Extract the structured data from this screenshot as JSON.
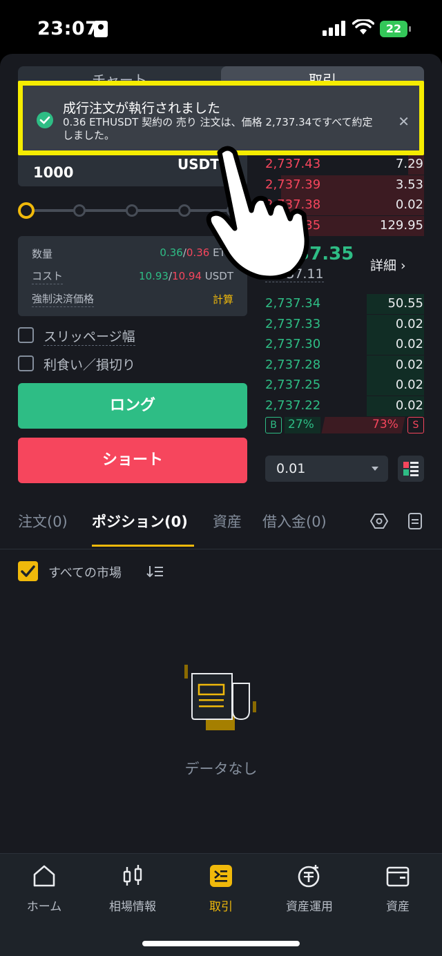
{
  "status_bar": {
    "time": "23:07",
    "battery": "22"
  },
  "top_tabs": [
    {
      "label": "チャート"
    },
    {
      "label": "取引"
    }
  ],
  "order_form": {
    "amount_value": "1000",
    "amount_unit": "USDT",
    "info": {
      "qty_label": "数量",
      "qty_val_a": "0.36",
      "qty_sep": "/",
      "qty_val_b": "0.36",
      "qty_unit": "ETH",
      "cost_label": "コスト",
      "cost_val_a": "10.93",
      "cost_sep": "/",
      "cost_val_b": "10.94",
      "cost_unit": "USDT",
      "liq_label": "強制決済価格",
      "liq_val": "計算"
    },
    "slippage_label": "スリッページ幅",
    "tpsl_label": "利食い／損切り",
    "long_label": "ロング",
    "short_label": "ショート"
  },
  "order_book": {
    "asks": [
      {
        "price": "2,737.43",
        "qty": "7.29",
        "depth": 0.1
      },
      {
        "price": "2,737.39",
        "qty": "3.53",
        "depth": 0.9
      },
      {
        "price": "2,737.38",
        "qty": "0.02",
        "depth": 0.9
      },
      {
        "price": "2,737.35",
        "qty": "129.95",
        "depth": 1.0
      }
    ],
    "mid_price": "2,737.35",
    "mark_price": "2,737.11",
    "detail_label": "詳細 ›",
    "bids": [
      {
        "price": "2,737.34",
        "qty": "50.55",
        "depth": 0.36
      },
      {
        "price": "2,737.33",
        "qty": "0.02",
        "depth": 0.36
      },
      {
        "price": "2,737.30",
        "qty": "0.02",
        "depth": 0.36
      },
      {
        "price": "2,737.28",
        "qty": "0.02",
        "depth": 0.36
      },
      {
        "price": "2,737.25",
        "qty": "0.02",
        "depth": 0.36
      },
      {
        "price": "2,737.22",
        "qty": "0.02",
        "depth": 0.36
      }
    ],
    "buy_tag": "B",
    "buy_pct": "27%",
    "sell_pct": "73%",
    "sell_tag": "S",
    "depth_value": "0.01"
  },
  "sub_tabs": [
    {
      "label": "注文(0)"
    },
    {
      "label": "ポジション(0)"
    },
    {
      "label": "資産"
    },
    {
      "label": "借入金(0)"
    }
  ],
  "filter_label": "すべての市場",
  "empty_text": "データなし",
  "bottom_nav": [
    {
      "label": "ホーム",
      "icon": "home-icon"
    },
    {
      "label": "相場情報",
      "icon": "candlestick-icon"
    },
    {
      "label": "取引",
      "icon": "trade-icon"
    },
    {
      "label": "資産運用",
      "icon": "earn-icon"
    },
    {
      "label": "資産",
      "icon": "wallet-icon"
    }
  ],
  "toast": {
    "title": "成行注文が執行されました",
    "body": "0.36 ETHUSDT 契約の  売り 注文は、価格 2,737.34ですべて約定しました。"
  },
  "colors": {
    "accent": "#f0b90b",
    "buy": "#2ebd85",
    "sell": "#f6465d",
    "highlight": "#f5ec00"
  }
}
